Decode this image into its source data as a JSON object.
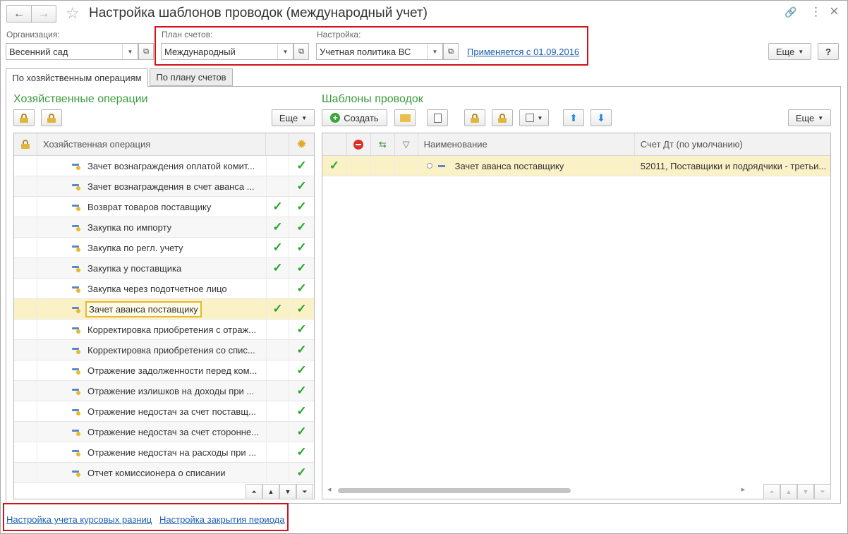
{
  "window": {
    "title": "Настройка шаблонов проводок (международный учет)"
  },
  "icons": {
    "back": "←",
    "forward": "→",
    "star": "☆",
    "link": "🔗",
    "menu": "⋮",
    "close": "×"
  },
  "org": {
    "label": "Организация:",
    "value": "Весенний сад"
  },
  "plan": {
    "label": "План счетов:",
    "value": "Международный"
  },
  "setting": {
    "label": "Настройка:",
    "value": "Учетная политика ВС",
    "link": "Применяется с 01.09.2016"
  },
  "top_more": "Еще",
  "help": "?",
  "tabs": [
    "По хозяйственным операциям",
    "По плану счетов"
  ],
  "left": {
    "title": "Хозяйственные операции",
    "more": "Еще",
    "column": "Хозяйственная операция",
    "rows": [
      {
        "name": "Зачет вознаграждения оплатой комит...",
        "c1": "",
        "c2": "✓"
      },
      {
        "name": "Зачет вознаграждения в счет аванса ...",
        "c1": "",
        "c2": "✓"
      },
      {
        "name": "Возврат товаров поставщику",
        "c1": "✓",
        "c2": "✓"
      },
      {
        "name": "Закупка по импорту",
        "c1": "✓",
        "c2": "✓"
      },
      {
        "name": "Закупка по регл. учету",
        "c1": "✓",
        "c2": "✓"
      },
      {
        "name": "Закупка у поставщика",
        "c1": "✓",
        "c2": "✓"
      },
      {
        "name": "Закупка через подотчетное лицо",
        "c1": "",
        "c2": "✓"
      },
      {
        "name": "Зачет аванса поставщику",
        "c1": "✓",
        "c2": "✓"
      },
      {
        "name": "Корректировка приобретения с отраж...",
        "c1": "",
        "c2": "✓"
      },
      {
        "name": "Корректировка приобретения со спис...",
        "c1": "",
        "c2": "✓"
      },
      {
        "name": "Отражение задолженности перед ком...",
        "c1": "",
        "c2": "✓"
      },
      {
        "name": "Отражение излишков на доходы при ...",
        "c1": "",
        "c2": "✓"
      },
      {
        "name": "Отражение недостач за счет поставщ...",
        "c1": "",
        "c2": "✓"
      },
      {
        "name": "Отражение недостач за счет сторонне...",
        "c1": "",
        "c2": "✓"
      },
      {
        "name": "Отражение недостач на расходы при ...",
        "c1": "",
        "c2": "✓"
      },
      {
        "name": "Отчет комиссионера о списании",
        "c1": "",
        "c2": "✓"
      }
    ]
  },
  "right": {
    "title": "Шаблоны проводок",
    "create": "Создать",
    "more": "Еще",
    "col_name": "Наименование",
    "col_dt": "Счет Дт (по умолчанию)",
    "rows": [
      {
        "check": "✓",
        "name": "Зачет аванса поставщику",
        "dt": "52011, Поставщики и подрядчики - третьи..."
      }
    ]
  },
  "footer": {
    "link1": "Настройка учета курсовых разниц",
    "link2": "Настройка закрытия периода"
  }
}
